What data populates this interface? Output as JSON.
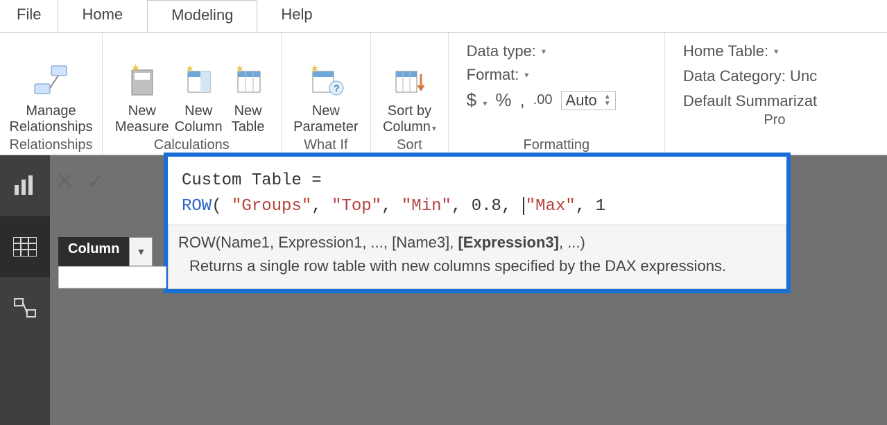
{
  "tabs": {
    "file": "File",
    "home": "Home",
    "modeling": "Modeling",
    "help": "Help"
  },
  "ribbon": {
    "relationships": {
      "manage": "Manage\nRelationships",
      "group": "Relationships"
    },
    "calculations": {
      "newMeasure": "New\nMeasure",
      "newColumn": "New\nColumn",
      "newTable": "New\nTable",
      "group": "Calculations"
    },
    "whatif": {
      "newParam": "New\nParameter",
      "group": "What If"
    },
    "sort": {
      "sortBy": "Sort by\nColumn",
      "group": "Sort"
    },
    "formatting": {
      "dataType": "Data type:",
      "format": "Format:",
      "dollar": "$",
      "percent": "%",
      "comma": ",",
      "decimals": ".00",
      "auto": "Auto",
      "group": "Formatting"
    },
    "properties": {
      "homeTable": "Home Table:",
      "dataCategory": "Data Category: Unc",
      "summarization": "Default Summarizat",
      "group": "Pro"
    }
  },
  "fieldWell": {
    "column": "Column"
  },
  "formula": {
    "line1": "Custom Table =",
    "row_kw": "ROW",
    "paren": "( ",
    "s1": "\"Groups\"",
    "c": ", ",
    "s2": "\"Top\"",
    "s3": "\"Min\"",
    "n1": "0.8",
    "s4": "\"Max\"",
    "n2": "1"
  },
  "intellisense": {
    "sig_pre": "ROW(Name1, Expression1, ..., [Name3], ",
    "sig_bold": "[Expression3]",
    "sig_post": ", ...)",
    "desc": "Returns a single row table with new columns specified by the DAX expressions."
  }
}
